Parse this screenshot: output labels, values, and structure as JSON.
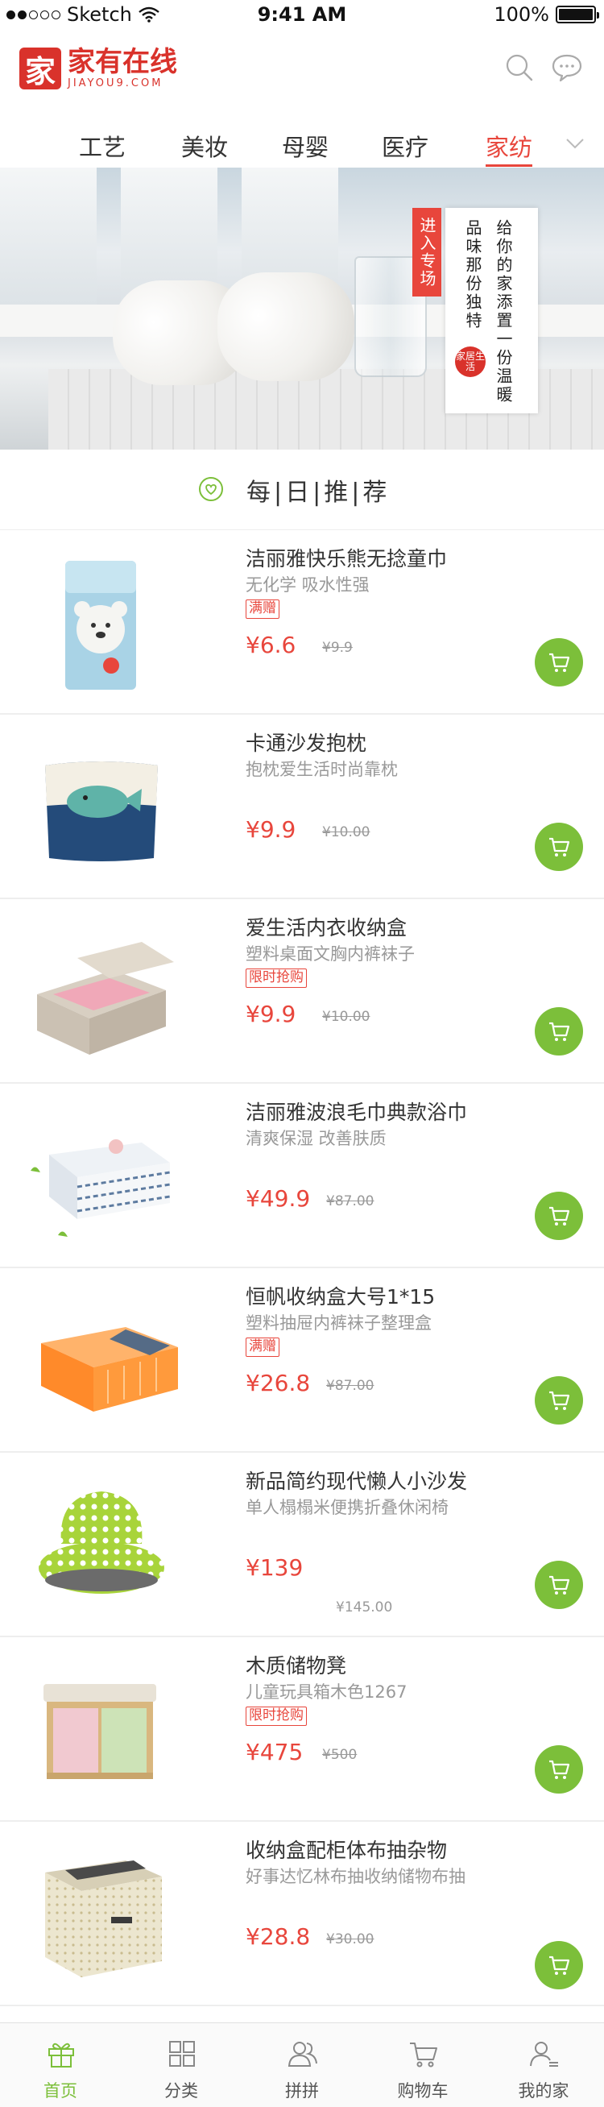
{
  "status_bar": {
    "carrier": "Sketch",
    "time": "9:41 AM",
    "battery": "100%"
  },
  "header": {
    "logo_mark": "家",
    "logo_cn": "家有在线",
    "logo_en": "JIAYOU9.COM",
    "icons": [
      "search-icon",
      "message-icon"
    ]
  },
  "tabs": {
    "items": [
      "工艺",
      "美妆",
      "母婴",
      "医疗",
      "家纺"
    ],
    "active_index": 4,
    "more_icon": "chevron-down-icon"
  },
  "banner": {
    "tag": "进入专场",
    "lines": [
      "给你的家添置一份温暖",
      "品味那份独特"
    ],
    "seal": "家居生活"
  },
  "daily": {
    "title": "每|日|推|荐",
    "icon": "heart-icon"
  },
  "products": [
    {
      "name": "洁丽雅快乐熊无捻童巾",
      "desc": "无化学 吸水性强",
      "badge": "满赠",
      "price": "¥6.6",
      "old_price": "¥9.9"
    },
    {
      "name": "卡通沙发抱枕",
      "desc": "抱枕爱生活时尚靠枕",
      "badge": "",
      "price": "¥9.9",
      "old_price": "¥10.00"
    },
    {
      "name": "爱生活内衣收纳盒",
      "desc": "塑料桌面文胸内裤袜子",
      "badge": "限时抢购",
      "price": "¥9.9",
      "old_price": "¥10.00"
    },
    {
      "name": "洁丽雅波浪毛巾典款浴巾",
      "desc": "清爽保湿 改善肤质",
      "badge": "",
      "price": "¥49.9",
      "old_price": "¥87.00"
    },
    {
      "name": "恒帆收纳盒大号1*15",
      "desc": "塑料抽屉内裤袜子整理盒",
      "badge": "满赠",
      "price": "¥26.8",
      "old_price": "¥87.00"
    },
    {
      "name": "新品简约现代懒人小沙发",
      "desc": "单人榻榻米便携折叠休闲椅",
      "badge": "",
      "price": "¥139",
      "old_price": "¥145.00"
    },
    {
      "name": "木质储物凳",
      "desc": "儿童玩具箱木色1267",
      "badge": "限时抢购",
      "price": "¥475",
      "old_price": "¥500"
    },
    {
      "name": "收纳盒配柜体布抽杂物",
      "desc": "好事达忆林布抽收纳储物布抽",
      "badge": "",
      "price": "¥28.8",
      "old_price": "¥30.00"
    }
  ],
  "tabbar": {
    "items": [
      {
        "label": "首页",
        "icon": "gift-home-icon",
        "active": true
      },
      {
        "label": "分类",
        "icon": "grid-icon",
        "active": false
      },
      {
        "label": "拼拼",
        "icon": "group-icon",
        "active": false
      },
      {
        "label": "购物车",
        "icon": "cart-icon",
        "active": false
      },
      {
        "label": "我的家",
        "icon": "profile-icon",
        "active": false
      }
    ]
  },
  "colors": {
    "accent_green": "#7cbf3a",
    "accent_red": "#e8463c",
    "brand_red": "#d9322b"
  }
}
